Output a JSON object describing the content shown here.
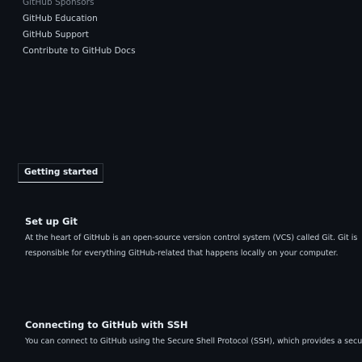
{
  "top_links": [
    {
      "label": "GitHub Sponsors"
    },
    {
      "label": "GitHub Education"
    },
    {
      "label": "GitHub Support"
    },
    {
      "label": "Contribute to GitHub Docs"
    }
  ],
  "getting_started": {
    "label": "Getting started"
  },
  "sections": {
    "setup": {
      "title": "Set up Git",
      "lines": [
        "At the heart of GitHub is an open-source version control system (VCS) called Git. Git is",
        "responsible for everything GitHub-related that happens locally on your computer."
      ]
    },
    "connect": {
      "title": "Connecting to GitHub with SSH",
      "lines": [
        "You can connect to GitHub using the Secure Shell Protocol (SSH), which provides a secure"
      ]
    }
  }
}
